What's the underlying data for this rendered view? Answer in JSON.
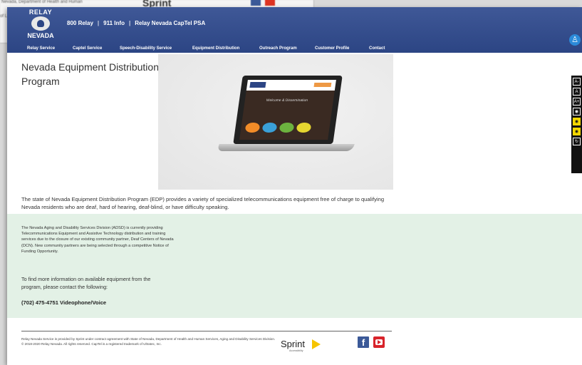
{
  "background_window": {
    "text1": "Nevada, Department of Health and Human",
    "text2": "of L",
    "sprint": "Sprint"
  },
  "header": {
    "logo_top": "RELAY",
    "logo_bottom": "NEVADA",
    "links": [
      "800 Relay",
      "911 Info",
      "Relay Nevada CapTel PSA"
    ],
    "separator": "|",
    "nav": [
      "Relay Service",
      "Captel Service",
      "Speech-Disability Service",
      "Equipment Distribution",
      "Outreach Program",
      "Customer Profile",
      "Contact"
    ],
    "accessibility_icon": "accessibility-icon"
  },
  "main": {
    "title": "Nevada Equipment Distribution Program",
    "hero_site_logo": "NVRID",
    "hero_welcome": "Welcome & Dissemination",
    "intro": "The state of Nevada Equipment Distribution Program (EDP) provides a variety of specialized telecommunications equipment free of charge to qualifying Nevada residents who are deaf, hard of hearing, deaf-blind, or have difficulty speaking."
  },
  "side_tools": [
    "A-",
    "A",
    "A+",
    "",
    "",
    "",
    ""
  ],
  "notice": {
    "adsd": "The Nevada Aging and Disability Services Division (ADSD) is currently providing Telecommunications Equipment and Assistive Technology distribution and training services due to the closure of our existing community partner, Deaf Centers of Nevada (DCN). New community partners are being selected through a competitive Notice of Funding Opportunity.",
    "find_more": "To find more information on available equipment from the program, please contact the following:",
    "phone": "(702) 475-4751 Videophone/Voice"
  },
  "footer": {
    "legal": "Relay Nevada Service is provided by Sprint under contract agreement with State of Nevada, Department of Health and Human Services, Aging and Disability Services Division. © 2018-2020 Relay Nevada. All rights reserved. CapTel is a registered trademark of Ultratec, Inc.",
    "sprint": "Sprint",
    "sprint_sub": "Accessibility",
    "facebook": "f"
  },
  "colors": {
    "header_blue": "#2c4584",
    "notice_green": "#e3f1e6",
    "accessibility_blue": "#2b8ad9"
  }
}
